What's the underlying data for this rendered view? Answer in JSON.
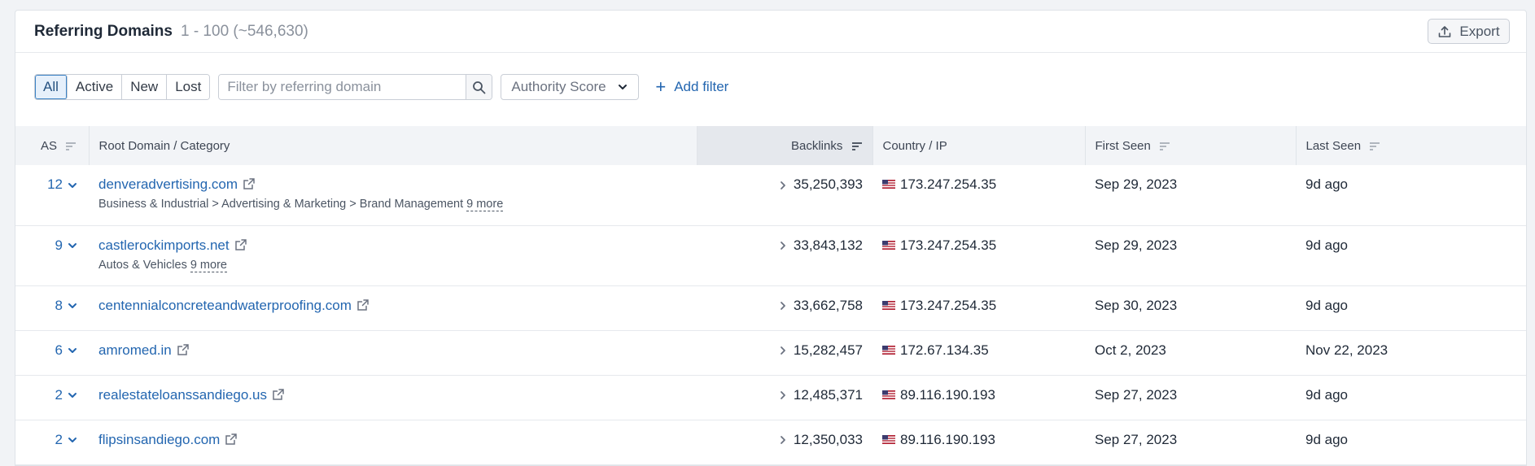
{
  "header": {
    "title": "Referring Domains",
    "range": "1 - 100 (~546,630)",
    "export_label": "Export"
  },
  "toolbar": {
    "segments": [
      "All",
      "Active",
      "New",
      "Lost"
    ],
    "active_segment": "All",
    "search_placeholder": "Filter by referring domain",
    "authority_select": "Authority Score",
    "add_filter_label": "Add filter"
  },
  "table": {
    "columns": {
      "as": "AS",
      "domain": "Root Domain / Category",
      "backlinks": "Backlinks",
      "country": "Country / IP",
      "first_seen": "First Seen",
      "last_seen": "Last Seen"
    },
    "rows": [
      {
        "as": "12",
        "domain": "denveradvertising.com",
        "category": "Business & Industrial > Advertising & Marketing > Brand Management",
        "more": "9 more",
        "backlinks": "35,250,393",
        "ip": "173.247.254.35",
        "first_seen": "Sep 29, 2023",
        "last_seen": "9d ago"
      },
      {
        "as": "9",
        "domain": "castlerockimports.net",
        "category": "Autos & Vehicles",
        "more": "9 more",
        "backlinks": "33,843,132",
        "ip": "173.247.254.35",
        "first_seen": "Sep 29, 2023",
        "last_seen": "9d ago"
      },
      {
        "as": "8",
        "domain": "centennialconcreteandwaterproofing.com",
        "category": "",
        "more": "",
        "backlinks": "33,662,758",
        "ip": "173.247.254.35",
        "first_seen": "Sep 30, 2023",
        "last_seen": "9d ago"
      },
      {
        "as": "6",
        "domain": "amromed.in",
        "category": "",
        "more": "",
        "backlinks": "15,282,457",
        "ip": "172.67.134.35",
        "first_seen": "Oct 2, 2023",
        "last_seen": "Nov 22, 2023"
      },
      {
        "as": "2",
        "domain": "realestateloanssandiego.us",
        "category": "",
        "more": "",
        "backlinks": "12,485,371",
        "ip": "89.116.190.193",
        "first_seen": "Sep 27, 2023",
        "last_seen": "9d ago"
      },
      {
        "as": "2",
        "domain": "flipsinsandiego.com",
        "category": "",
        "more": "",
        "backlinks": "12,350,033",
        "ip": "89.116.190.193",
        "first_seen": "Sep 27, 2023",
        "last_seen": "9d ago"
      }
    ]
  },
  "colors": {
    "link": "#2366b0",
    "active_segment_bg": "#e6f0fb",
    "header_bg": "#f2f4f7"
  },
  "icons": {
    "export": "upload-icon",
    "search": "magnifier-icon",
    "sort": "sort-lines-icon",
    "expand": "chevron-down-icon",
    "external": "external-link-icon",
    "flag": "us-flag-icon"
  }
}
